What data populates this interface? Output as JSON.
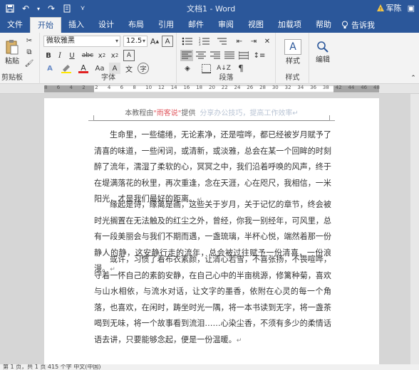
{
  "app": {
    "title": "文档1 - Word",
    "user": "军陈"
  },
  "tabs": [
    {
      "label": "文件"
    },
    {
      "label": "开始"
    },
    {
      "label": "插入"
    },
    {
      "label": "设计"
    },
    {
      "label": "布局"
    },
    {
      "label": "引用"
    },
    {
      "label": "邮件"
    },
    {
      "label": "审阅"
    },
    {
      "label": "视图"
    },
    {
      "label": "加载项"
    },
    {
      "label": "帮助"
    }
  ],
  "tell_me": "告诉我",
  "ribbon": {
    "clipboard": {
      "paste": "粘贴",
      "label": "剪贴板"
    },
    "font": {
      "name": "微软雅黑",
      "size": "12.5",
      "label": "字体"
    },
    "paragraph": {
      "label": "段落"
    },
    "styles": {
      "button": "样式",
      "label": "样式"
    },
    "editing": {
      "button": "编辑"
    }
  },
  "ruler": {
    "numbers": [
      "8",
      "6",
      "4",
      "2",
      "2",
      "4",
      "6",
      "8",
      "10",
      "12",
      "14",
      "16",
      "18",
      "20",
      "22",
      "24",
      "26",
      "28",
      "30",
      "32",
      "34",
      "36",
      "38",
      "42",
      "44",
      "46",
      "48"
    ]
  },
  "doc": {
    "header": {
      "prefix": "本教程由",
      "highlight": "\"雨客说\"",
      "suffix": "提供",
      "watermark": "分享办公技巧，提高工作效率↵"
    },
    "paragraphs": [
      "生命里，一些缱绻，无论素净，还是喧哗，都已经被岁月赋予了清喜的味道，一些闲词，或清新，或淡雅，总会在某一个回眸的时刻醉了流年，濡湿了柔软的心，冥冥之中，我们沿着呼唤的风声，终于在堤满落花的秋里，再次重逢，念在天涯，心在咫尺，我相信，一米阳光，才是我们最好的距离。",
      "缘起是诗，缘离是画，这些关于岁月，关于记忆的章节，终会被时光搁置在无法触及的红尘之外，曾经，你我一别经年，可风里，总有一段美丽会与我们不期而遇，一盏琉璃，半杯心悦，端然着那一份静人的静，这安静行走的流年，总会被过往赋予一份清喜，一份浪漫。",
      "或许，习惯了着布衣素颜，让清心若雪，不喜张扬，不畏喧哗，守着一怀自己的素韵安静，在自己心中的半亩桃源，修篱种菊，喜欢与山水相依，与流水对话，让文字的墨香，依附在心灵的每一个角落，也喜欢，在闲时，踌坐时光一隅，将一本书读到无字，将一盏茶喝到无味，将一个故事看到流泪……心染尘香，不须有多少的柔情话语去讲，只要能够念起，便是一份温暖。"
    ],
    "para_mark": "↵"
  },
  "statusbar": {
    "text": "第 1 页，共 1 页    415 个字    中文(中国)"
  },
  "colors": {
    "accent": "#2b579a",
    "header_red": "#e0585f"
  }
}
